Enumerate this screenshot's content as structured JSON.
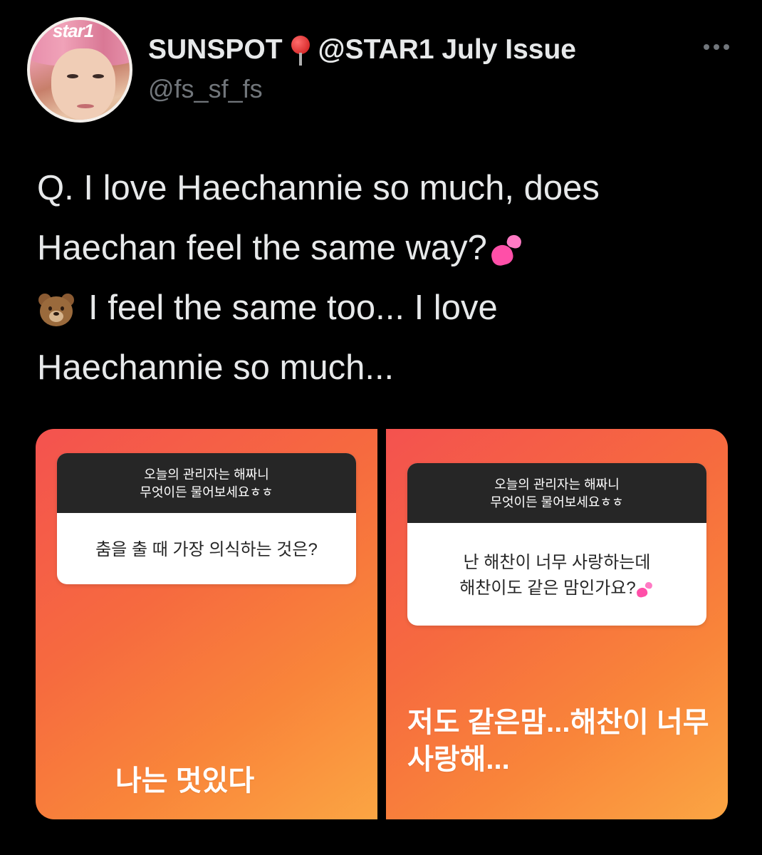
{
  "header": {
    "avatar_text": "star1",
    "display_name_part1": "SUNSPOT",
    "display_name_part2": "@STAR1 July Issue",
    "handle": "@fs_sf_fs"
  },
  "tweet": {
    "line1": "Q. I love Haechannie so much, does",
    "line2": "Haechan feel the same way?",
    "line3": "I feel the same too... I love",
    "line4": "Haechannie so much..."
  },
  "media": {
    "story_left": {
      "header_line1": "오늘의 관리자는 해짜니",
      "header_line2": "무엇이든 물어보세요ㅎㅎ",
      "question": "춤을 출 때 가장 의식하는 것은?",
      "answer": "나는 멋있다"
    },
    "story_right": {
      "header_line1": "오늘의 관리자는 해짜니",
      "header_line2": "무엇이든 물어보세요ㅎㅎ",
      "question_line1": "난 해찬이 너무 사랑하는데",
      "question_line2": "해찬이도 같은 맘인가요?",
      "answer_line1": "저도 같은맘...해찬이 너무",
      "answer_line2": "사랑해..."
    }
  },
  "icons": {
    "pin": "round-pushpin-icon",
    "more": "more-options-icon",
    "hearts": "two-hearts-icon",
    "bear": "bear-face-icon"
  },
  "colors": {
    "background": "#000000",
    "text_primary": "#e7e9ea",
    "text_secondary": "#71767b",
    "story_gradient_start": "#f4524f",
    "story_gradient_end": "#fba543"
  }
}
